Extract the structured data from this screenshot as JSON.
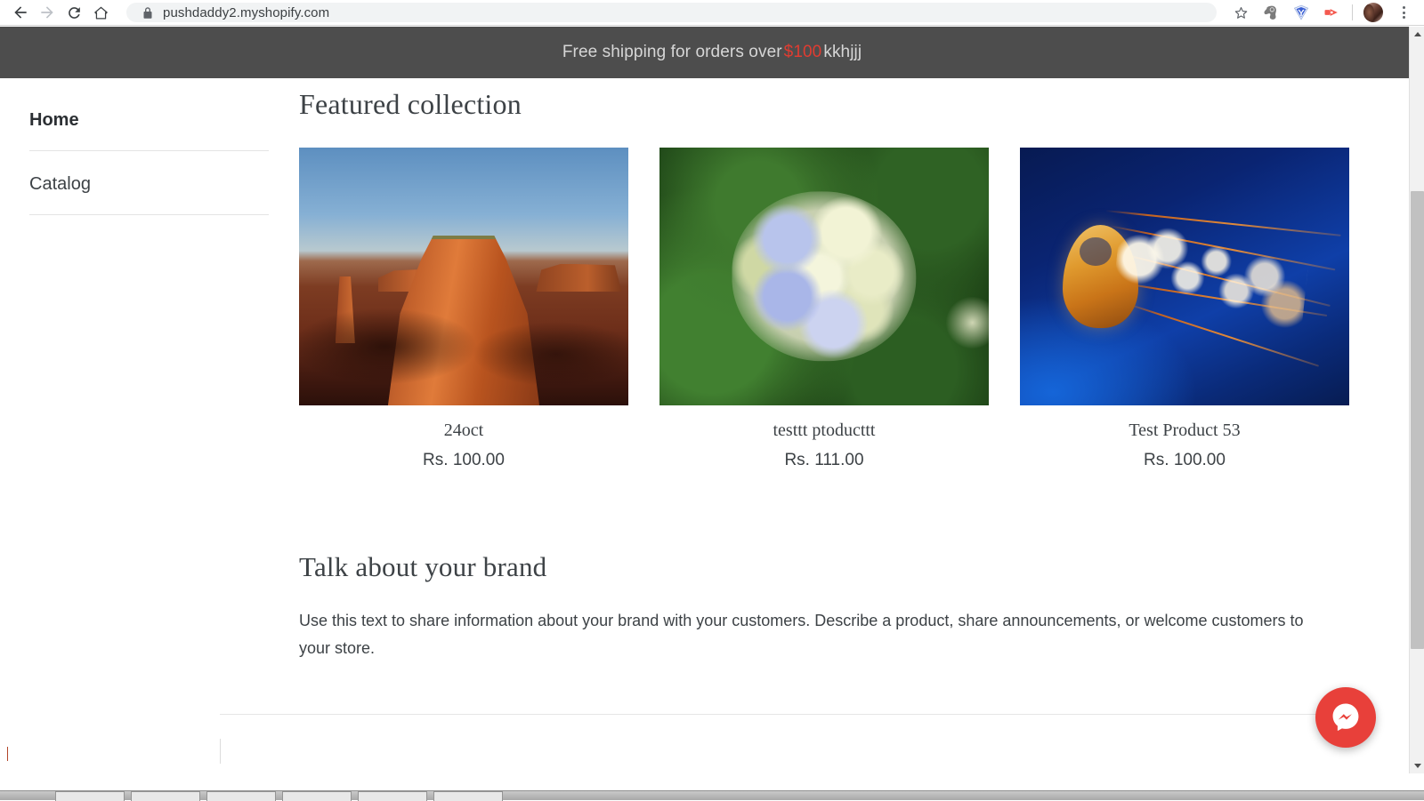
{
  "browser": {
    "url": "pushdaddy2.myshopify.com",
    "back_label": "Back",
    "forward_label": "Forward",
    "reload_label": "Reload",
    "home_label": "Home",
    "bookmark_label": "Bookmark this tab",
    "extension1_label": "Extension",
    "extension2_label": "Yandex extension",
    "extension3_label": "Media extension",
    "profile_label": "Profile",
    "menu_label": "Customize and control Google Chrome"
  },
  "announcement": {
    "prefix": "Free shipping for orders over",
    "amount": "$100",
    "suffix": "kkhjjj",
    "highlight_color": "#e03c31",
    "background_color": "#4d4d4d"
  },
  "sidebar": {
    "items": [
      {
        "label": "Home",
        "active": true
      },
      {
        "label": "Catalog",
        "active": false
      }
    ]
  },
  "main": {
    "featured_title": "Featured collection",
    "products": [
      {
        "title": "24oct",
        "price": "Rs. 100.00",
        "image": "desert-butte-photo"
      },
      {
        "title": "testtt ptoducttt",
        "price": "Rs. 111.00",
        "image": "hydrangea-flower-photo"
      },
      {
        "title": "Test Product 53",
        "price": "Rs. 100.00",
        "image": "jellyfish-photo"
      }
    ],
    "brand_title": "Talk about your brand",
    "brand_text": "Use this text to share information about your brand with your customers. Describe a product, share announcements, or welcome customers to your store."
  },
  "widgets": {
    "messenger_label": "Chat with us on Messenger",
    "messenger_color": "#e8403a"
  },
  "scrollbar": {
    "up_label": "Scroll up",
    "down_label": "Scroll down",
    "thumb_label": "Vertical scrollbar"
  }
}
